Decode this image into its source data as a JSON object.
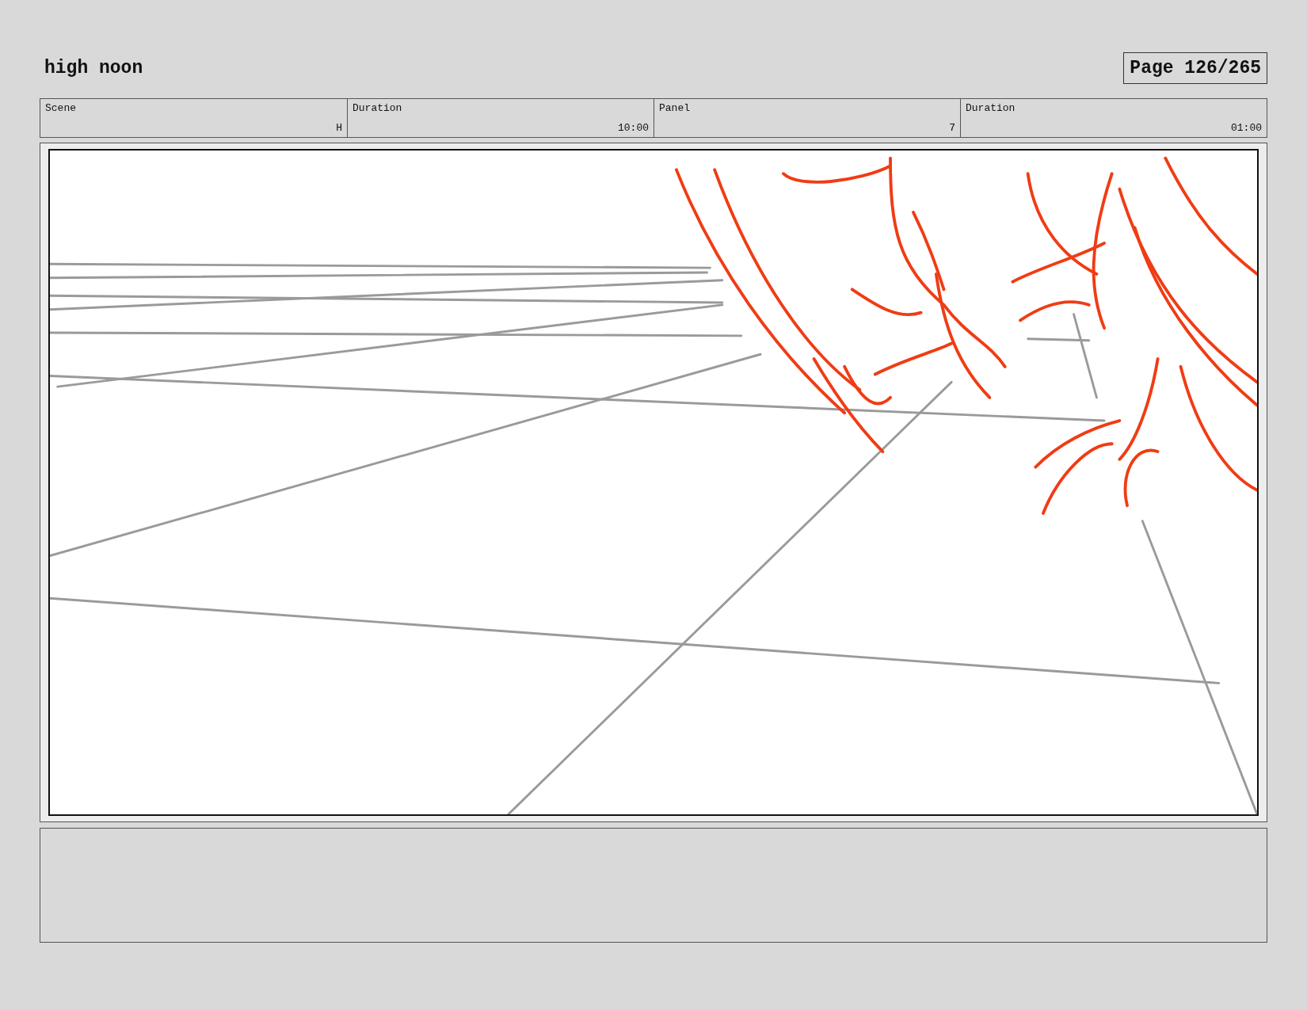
{
  "title": "high noon",
  "page": "Page 126/265",
  "header": [
    {
      "label": "Scene",
      "value": "H"
    },
    {
      "label": "Duration",
      "value": "10:00"
    },
    {
      "label": "Panel",
      "value": "7"
    },
    {
      "label": "Duration",
      "value": "01:00"
    }
  ]
}
